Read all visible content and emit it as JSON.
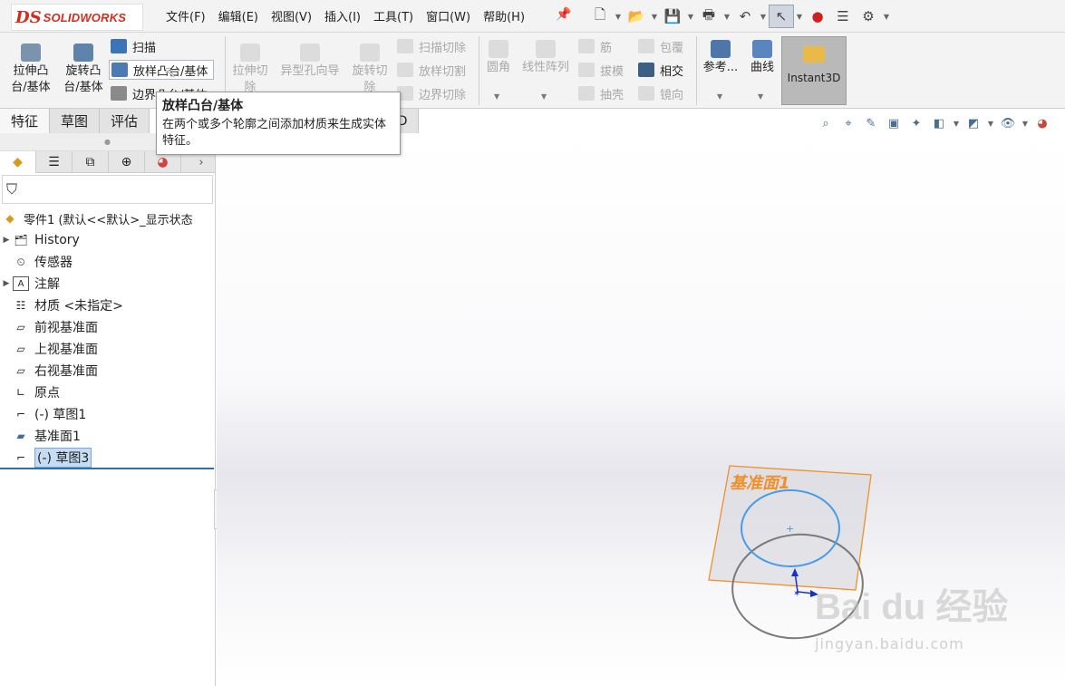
{
  "app": {
    "logo_ds": "DS",
    "logo_text": "SOLIDWORKS"
  },
  "menu": [
    "文件(F)",
    "编辑(E)",
    "视图(V)",
    "插入(I)",
    "工具(T)",
    "窗口(W)",
    "帮助(H)"
  ],
  "commands": {
    "extrude_boss": [
      "拉伸凸",
      "台/基体"
    ],
    "revolve_boss": [
      "旋转凸",
      "台/基体"
    ],
    "sweep": "扫描",
    "loft": "放样凸台/基体",
    "boundary": "边界凸台/基体",
    "extrude_cut": [
      "拉伸切",
      "除"
    ],
    "hole_wizard": "异型孔向导",
    "revolve_cut": [
      "旋转切",
      "除"
    ],
    "swept_cut": "扫描切除",
    "lofted_cut": "放样切割",
    "boundary_cut": "边界切除",
    "fillet": "圆角",
    "linear_pattern": "线性阵列",
    "rib": "筋",
    "draft": "拔模",
    "shell": "抽壳",
    "wrap": "包覆",
    "intersect": "相交",
    "mirror": "镜向",
    "reference": "参考...",
    "curves": "曲线",
    "instant3d": "Instant3D"
  },
  "tabs": [
    "特征",
    "草图",
    "评估",
    "DWORKS MBD"
  ],
  "tooltip": {
    "title": "放样凸台/基体",
    "desc": "在两个或多个轮廓之间添加材质来生成实体特征。"
  },
  "tree": {
    "root": "零件1 (默认<<默认>_显示状态",
    "items": [
      {
        "label": "History",
        "expandable": true
      },
      {
        "label": "传感器",
        "expandable": false
      },
      {
        "label": "注解",
        "expandable": true
      },
      {
        "label": "材质 <未指定>",
        "expandable": false
      },
      {
        "label": "前视基准面",
        "expandable": false
      },
      {
        "label": "上视基准面",
        "expandable": false
      },
      {
        "label": "右视基准面",
        "expandable": false
      },
      {
        "label": "原点",
        "expandable": false
      },
      {
        "label": "(-) 草图1",
        "expandable": false
      },
      {
        "label": "基准面1",
        "expandable": false
      },
      {
        "label": "(-) 草图3",
        "expandable": false,
        "selected": true
      }
    ]
  },
  "graphics": {
    "plane_label": "基准面1"
  },
  "watermark": {
    "brand": "Bai du 经验",
    "url": "jingyan.baidu.com"
  },
  "colors": {
    "plane": "#f0902a",
    "sketch_active": "#4a9be8",
    "sketch_inactive": "#7a7a7a",
    "triad": "#1532c8",
    "selection": "#c5dcf3"
  }
}
